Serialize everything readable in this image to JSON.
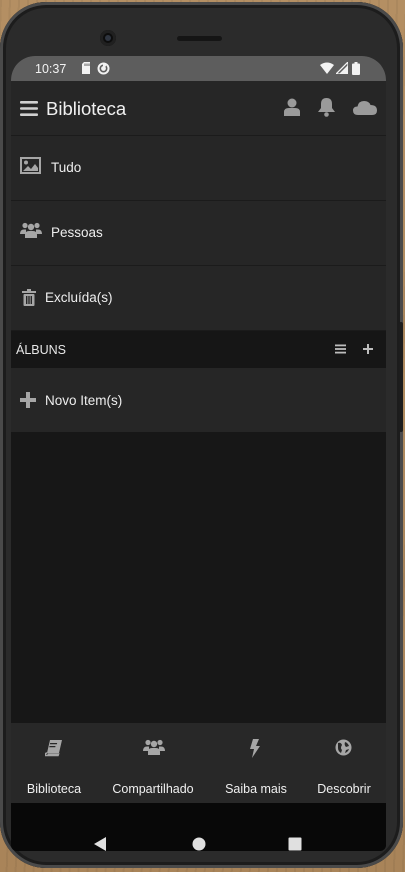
{
  "status_bar": {
    "time": "10:37",
    "icons": [
      "sd-card-icon",
      "sync-icon",
      "wifi-icon",
      "signal-icon",
      "battery-icon"
    ]
  },
  "app_bar": {
    "title": "Biblioteca",
    "icons": [
      "hamburger-menu-icon",
      "user-icon",
      "bell-icon",
      "cloud-icon"
    ]
  },
  "menu": [
    {
      "label": "Tudo",
      "icon": "image-icon"
    },
    {
      "label": "Pessoas",
      "icon": "people-icon"
    },
    {
      "label": "Excluída(s)",
      "icon": "trash-icon"
    }
  ],
  "albums_section": {
    "title": "ÁLBUNS",
    "actions": [
      "list-view-icon",
      "add-album-icon"
    ],
    "new_item_label": "Novo Item(s)"
  },
  "bottom_nav": [
    {
      "label": "Biblioteca",
      "icon": "book-icon"
    },
    {
      "label": "Compartilhado",
      "icon": "shared-people-icon"
    },
    {
      "label": "Saiba mais",
      "icon": "lightning-icon"
    },
    {
      "label": "Descobrir",
      "icon": "globe-icon"
    }
  ],
  "system_nav": [
    "back-icon",
    "home-icon",
    "recents-icon"
  ],
  "colors": {
    "background": "#171717",
    "surface": "#262626",
    "section_header": "#161616",
    "status_bar": "#5d5d5d",
    "icon": "#a6a6a6",
    "text": "#eeeeee"
  }
}
